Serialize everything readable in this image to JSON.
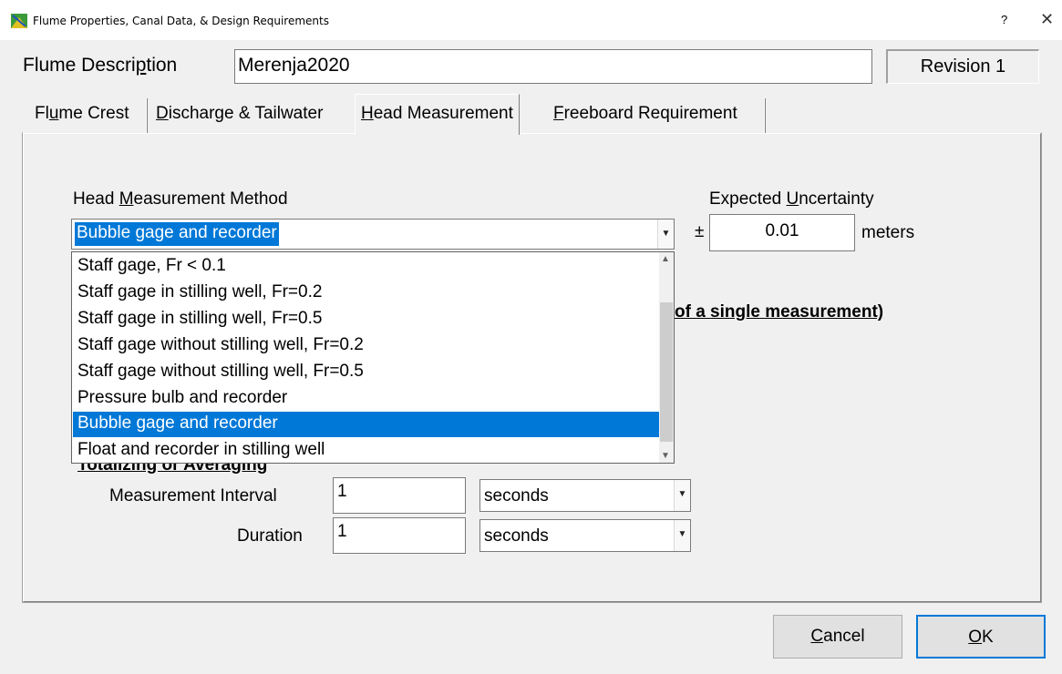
{
  "window": {
    "title": "Flume Properties, Canal Data, & Design Requirements",
    "help": "?",
    "close": "✕"
  },
  "header": {
    "flume_description_label": "Flume Description",
    "flume_description_value": "Merenja2020",
    "revision": "Revision 1"
  },
  "tabs": [
    {
      "label": "Flume Crest",
      "selected": false
    },
    {
      "label": "Discharge & Tailwater",
      "selected": false
    },
    {
      "label": "Head Measurement",
      "selected": true
    },
    {
      "label": "Freeboard Requirement",
      "selected": false
    }
  ],
  "head_measurement": {
    "method_label": "Head Measurement Method",
    "method_selected": "Bubble gage and recorder",
    "method_options": [
      "Staff gage, Fr < 0.1",
      "Staff gage in stilling well, Fr=0.2",
      "Staff gage in stilling well, Fr=0.5",
      "Staff gage without stilling well, Fr=0.2",
      "Staff gage without stilling well, Fr=0.5",
      "Pressure bulb and recorder",
      "Bubble gage and recorder",
      "Float and recorder in stilling well"
    ],
    "uncertainty_label": "Expected Uncertainty",
    "plus_minus": "±",
    "uncertainty_value": "0.01",
    "uncertainty_unit": "meters",
    "single_measurement_text": "of a single measurement)",
    "totalizing_text": "Totalizing or Averaging",
    "interval_label": "Measurement Interval",
    "interval_value": "1",
    "interval_unit": "seconds",
    "duration_label": "Duration",
    "duration_value": "1",
    "duration_unit": "seconds"
  },
  "buttons": {
    "cancel": "Cancel",
    "ok": "OK"
  },
  "colors": {
    "selection": "#0078d7",
    "dialog_bg": "#f0f0f0"
  }
}
